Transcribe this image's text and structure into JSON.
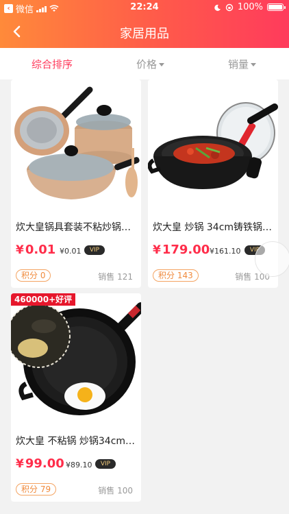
{
  "status": {
    "carrier": "微信",
    "time": "22:24",
    "battery": "100%"
  },
  "nav": {
    "title": "家居用品"
  },
  "sort": {
    "comprehensive": "综合排序",
    "price": "价格",
    "sales": "销量"
  },
  "products": [
    {
      "title": "炊大皇锅具套装不粘炒锅…",
      "price": "0.01",
      "vip_price": "¥0.01",
      "vip": "VIP",
      "points": "积分 0",
      "sales": "销售 121",
      "tag": ""
    },
    {
      "title": "炊大皇 炒锅 34cm铸铁锅…",
      "price": "179.00",
      "vip_price": "¥161.10",
      "vip": "VIP",
      "points": "积分 143",
      "sales": "销售 100",
      "tag": ""
    },
    {
      "title": "炊大皇 不粘锅 炒锅34cm…",
      "price": "99.00",
      "vip_price": "¥89.10",
      "vip": "VIP",
      "points": "积分 79",
      "sales": "销售 100",
      "tag": "460000+好评"
    }
  ],
  "currency_symbol": "¥",
  "colors": {
    "accent": "#ff3b5c",
    "header_start": "#ff8a3a",
    "price": "#ff2d4a",
    "points": "#f08a3c"
  }
}
